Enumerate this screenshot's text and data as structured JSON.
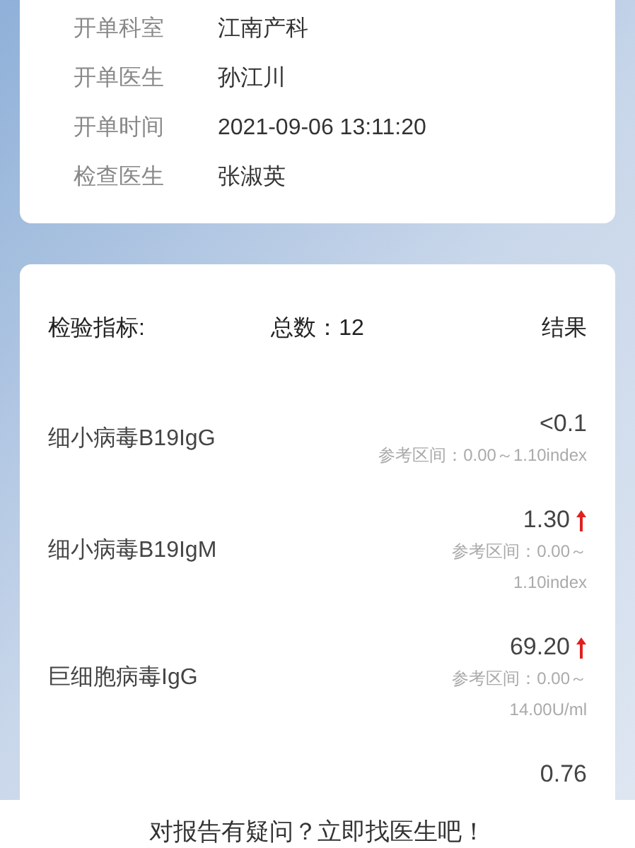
{
  "order_info": [
    {
      "label": "开单科室",
      "value": "江南产科"
    },
    {
      "label": "开单医生",
      "value": "孙江川"
    },
    {
      "label": "开单时间",
      "value": "2021-09-06 13:11:20"
    },
    {
      "label": "检查医生",
      "value": "张淑英"
    }
  ],
  "results": {
    "header": {
      "indicator": "检验指标:",
      "total": "总数：12",
      "result": "结果"
    },
    "items": [
      {
        "name": "细小病毒B19IgG",
        "value": "<0.1",
        "high": false,
        "reference": "参考区间：0.00～1.10index"
      },
      {
        "name": "细小病毒B19IgM",
        "value": "1.30",
        "high": true,
        "reference": "参考区间：0.00～1.10index"
      },
      {
        "name": "巨细胞病毒IgG",
        "value": "69.20",
        "high": true,
        "reference": "参考区间：0.00～14.00U/ml"
      },
      {
        "value": "0.76",
        "high": false
      }
    ]
  },
  "footer_banner": "对报告有疑问？立即找医生吧！"
}
